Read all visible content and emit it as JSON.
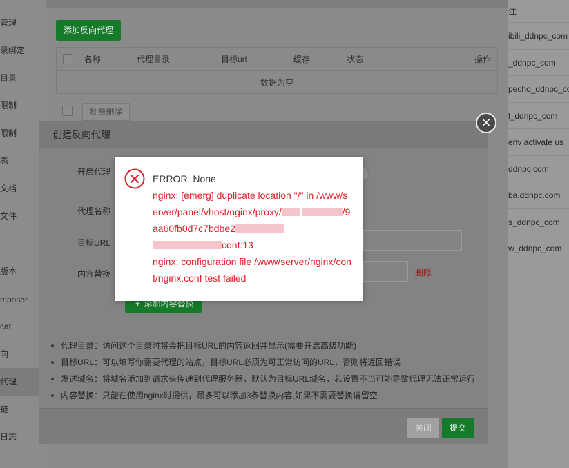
{
  "sidebar": {
    "items": [
      {
        "label": "管理",
        "active": false
      },
      {
        "label": "录绑定",
        "active": false
      },
      {
        "label": "目录",
        "active": false
      },
      {
        "label": "限制",
        "active": false
      },
      {
        "label": "限制",
        "active": false
      },
      {
        "label": "态",
        "active": false
      },
      {
        "label": "文档",
        "active": false
      },
      {
        "label": "文件",
        "active": false
      },
      {
        "label": "版本",
        "active": false
      },
      {
        "label": "mposer",
        "active": false
      },
      {
        "label": "cat",
        "active": false
      },
      {
        "label": "向",
        "active": false
      },
      {
        "label": "代理",
        "active": true
      },
      {
        "label": "链",
        "active": false
      },
      {
        "label": "日志",
        "active": false
      }
    ]
  },
  "proxy_panel": {
    "add_button": "添加反向代理",
    "table": {
      "headers": [
        "名称",
        "代理目录",
        "目标url",
        "缓存",
        "状态",
        "操作"
      ],
      "empty_text": "数据为空"
    },
    "batch_delete": "批量删除"
  },
  "site_list": {
    "header": "注",
    "items": [
      "ibili_ddnpc_com",
      "_ddnpc_com",
      "pecho_ddnpc_com",
      "l_ddnpc_com",
      "env activate us",
      "ddnpc.com",
      "ba.ddnpc.com",
      "s_ddnpc_com",
      "w_ddnpc_com"
    ]
  },
  "dialog": {
    "title": "创建反向代理",
    "close_icon": "×",
    "labels": {
      "enable_proxy": "开启代理",
      "proxy_name": "代理名称",
      "target_url": "目标URL",
      "content_replace": "内容替换"
    },
    "delete_link": "删除",
    "add_replace_button": "添加内容替换",
    "tips": [
      "代理目录：访问这个目录时将会把目标URL的内容返回并显示(需要开启高级功能)",
      "目标URL：可以填写你需要代理的站点，目标URL必须为可正常访问的URL，否则将返回错误",
      "发送域名：将域名添加到请求头传递到代理服务器，默认为目标URL域名，若设置不当可能导致代理无法正常运行",
      "内容替换：只能在使用nginx时提供，最多可以添加3条替换内容,如果不需要替换请留空"
    ],
    "footer": {
      "close": "关闭",
      "submit": "提交"
    }
  },
  "error_popup": {
    "icon": "error-x-circle-icon",
    "title": "ERROR: None",
    "line1_prefix": "nginx: [emerg] duplicate location \"/\" in /www/server/panel/vhost/nginx/proxy/",
    "line1_mid": "/9aa60fb0d7c7bdbe2",
    "line1_suffix": "conf:13",
    "line2": "nginx: configuration file /www/server/nginx/conf/nginx.conf test failed",
    "color": "#e0212a"
  }
}
